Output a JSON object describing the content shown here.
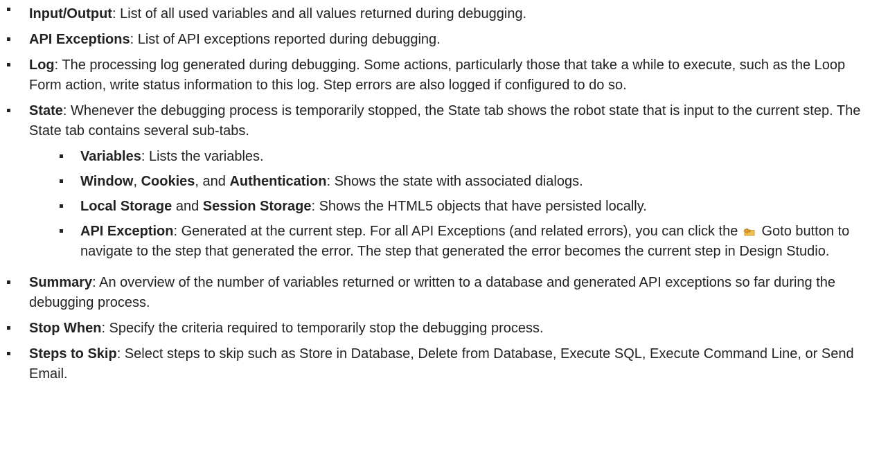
{
  "items": {
    "io": {
      "term": "Input/Output",
      "text": ": List of all used variables and all values returned during debugging."
    },
    "api": {
      "term": "API Exceptions",
      "text": ": List of API exceptions reported during debugging."
    },
    "log": {
      "term": "Log",
      "text": ": The processing log generated during debugging. Some actions, particularly those that take a while to execute, such as the Loop Form action, write status information to this log. Step errors are also logged if configured to do so."
    },
    "state": {
      "term": "State",
      "text": ": Whenever the debugging process is temporarily stopped, the State tab shows the robot state that is input to the current step. The State tab contains several sub-tabs.",
      "sub": {
        "vars": {
          "term": "Variables",
          "text": ": Lists the variables."
        },
        "window": {
          "term1": "Window",
          "sep1": ", ",
          "term2": "Cookies",
          "sep2": ", and ",
          "term3": "Authentication",
          "text": ": Shows the state with associated dialogs."
        },
        "storage": {
          "term1": "Local Storage",
          "sep1": " and ",
          "term2": "Session Storage",
          "text": ": Shows the HTML5 objects that have persisted locally."
        },
        "apiex": {
          "term": "API Exception",
          "text_before": ": Generated at the current step. For all API Exceptions (and related errors), you can click the",
          "icon": "goto-icon",
          "text_after": "Goto button to navigate to the step that generated the error. The step that generated the error becomes the current step in Design Studio."
        }
      }
    },
    "summary": {
      "term": "Summary",
      "text": ": An overview of the number of variables returned or written to a database and generated API exceptions so far during the debugging process."
    },
    "stop": {
      "term": "Stop When",
      "text": ": Specify the criteria required to temporarily stop the debugging process."
    },
    "skip": {
      "term": "Steps to Skip",
      "text": ": Select steps to skip such as Store in Database, Delete from Database, Execute SQL, Execute Command Line, or Send Email."
    }
  },
  "colors": {
    "text": "#222222",
    "icon_arrow": "#e8a33a",
    "icon_folder": "#f0c24a"
  }
}
